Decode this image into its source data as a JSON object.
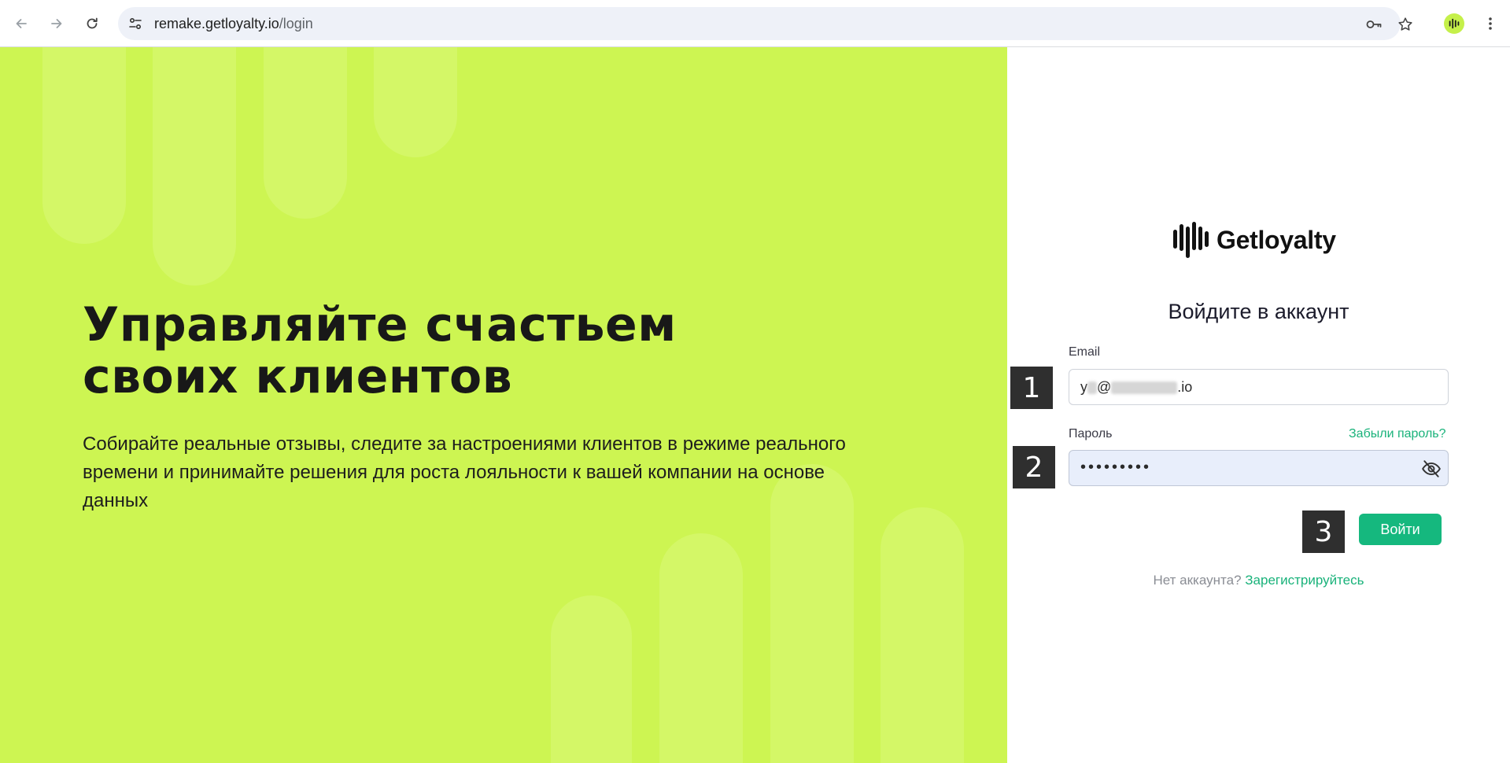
{
  "browser": {
    "url_host": "remake.getloyalty.io",
    "url_path": "/login",
    "icons": [
      "back-arrow-icon",
      "forward-arrow-icon",
      "reload-icon",
      "site-info-icon",
      "password-key-icon",
      "bookmark-star-icon",
      "extension-icon",
      "kebab-menu-icon"
    ]
  },
  "hero": {
    "title_line1": "Управляйте счастьем",
    "title_line2": "своих клиентов",
    "description": "Собирайте реальные отзывы, следите за настроениями клиентов в режиме реального времени и принимайте решения для роста лояльности к вашей компании на основе данных",
    "background_color": "#cdf552"
  },
  "login": {
    "logo_text": "Getloyalty",
    "heading": "Войдите в аккаунт",
    "email_label": "Email",
    "email_value_start": "y",
    "email_value_at": "@",
    "email_value_end": ".io",
    "password_label": "Пароль",
    "password_value": "•••••••••",
    "forgot_link": "Забыли пароль?",
    "submit_label": "Войти",
    "signup_prompt": "Нет аккаунта?",
    "signup_link": "Зарегистрируйтесь",
    "accent_color": "#15b87e"
  },
  "markers": [
    "1",
    "2",
    "3"
  ]
}
